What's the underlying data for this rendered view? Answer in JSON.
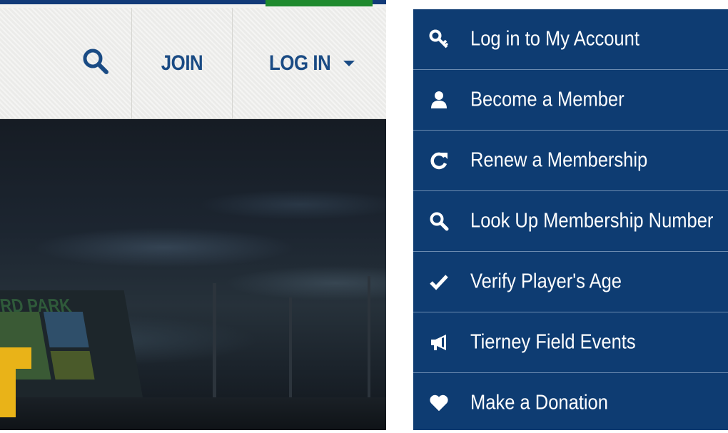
{
  "header": {
    "join_label": "JOIN",
    "login_label": "LOG IN",
    "colors": {
      "nav_text": "#1a4b84",
      "header_bg": "#efefed",
      "top_navy": "#123a78",
      "top_green": "#1f8a2e"
    }
  },
  "hero": {
    "signage_text": "ORD PARK"
  },
  "dropdown": {
    "background": "#0e3c72",
    "items": [
      {
        "label": "Log in to My Account",
        "icon": "key-icon"
      },
      {
        "label": "Become a Member",
        "icon": "user-icon"
      },
      {
        "label": "Renew a Membership",
        "icon": "refresh-icon"
      },
      {
        "label": "Look Up Membership Number",
        "icon": "search-icon"
      },
      {
        "label": "Verify Player's Age",
        "icon": "checkmark-icon"
      },
      {
        "label": "Tierney Field Events",
        "icon": "megaphone-icon"
      },
      {
        "label": "Make a Donation",
        "icon": "heart-icon"
      }
    ]
  }
}
